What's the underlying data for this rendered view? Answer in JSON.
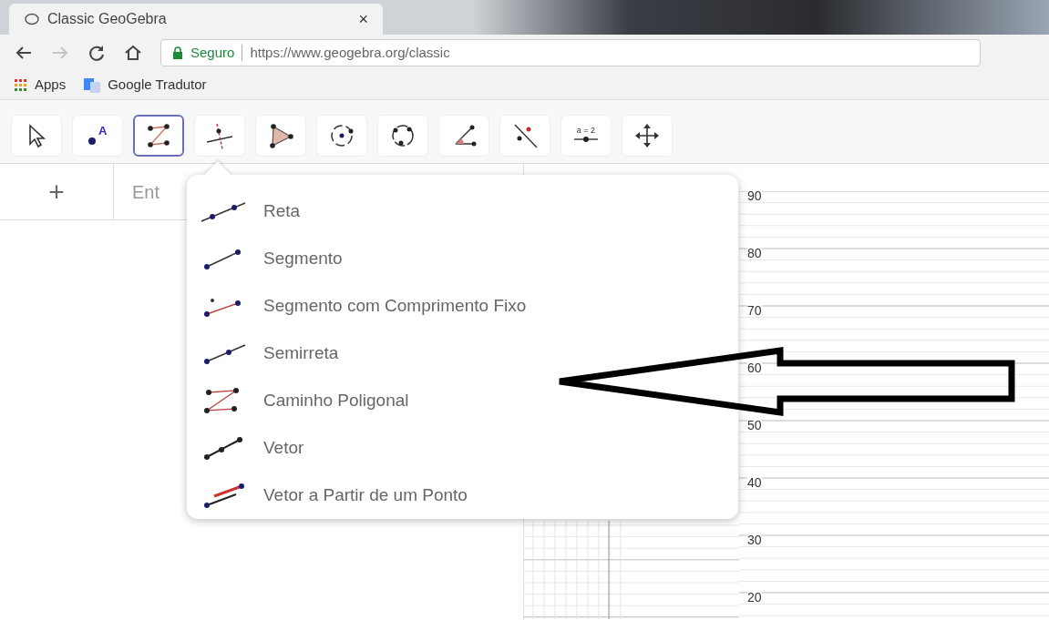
{
  "browser": {
    "tab": {
      "title": "Classic GeoGebra",
      "close": "×"
    },
    "nav": {
      "forward_disabled": true
    },
    "address": {
      "security": "Seguro",
      "url": "https://www.geogebra.org/classic"
    },
    "bookmarks": [
      {
        "label": "Apps"
      },
      {
        "label": "Google Tradutor"
      }
    ]
  },
  "toolbar": {
    "tools": [
      {
        "selected": false
      },
      {
        "selected": false,
        "glyph": "A"
      },
      {
        "selected": true
      },
      {
        "selected": false
      },
      {
        "selected": false
      },
      {
        "selected": false
      },
      {
        "selected": false
      },
      {
        "selected": false
      },
      {
        "selected": false
      },
      {
        "selected": false,
        "glyph": "a = 2"
      },
      {
        "selected": false
      }
    ]
  },
  "algebra": {
    "add": "+",
    "input_value": "Ent"
  },
  "menu": {
    "items": [
      {
        "label": "Reta"
      },
      {
        "label": "Segmento"
      },
      {
        "label": "Segmento com Comprimento Fixo"
      },
      {
        "label": "Semirreta"
      },
      {
        "label": "Caminho Poligonal"
      },
      {
        "label": "Vetor"
      },
      {
        "label": "Vetor a Partir de um Ponto"
      }
    ]
  },
  "graphics": {
    "y_labels": [
      "90",
      "80",
      "70",
      "60",
      "50",
      "40",
      "30",
      "20"
    ]
  },
  "annotation": {
    "kind": "arrow"
  }
}
